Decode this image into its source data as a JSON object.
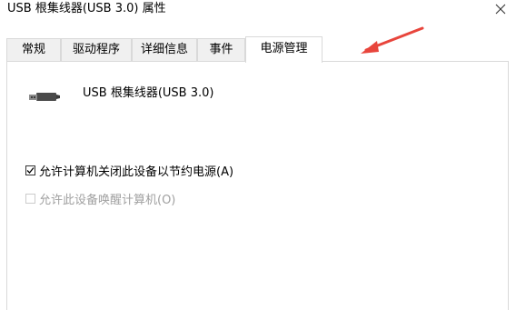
{
  "window": {
    "title": "USB 根集线器(USB 3.0) 属性",
    "close_glyph": "✕"
  },
  "tabs": [
    {
      "label": "常规",
      "active": false
    },
    {
      "label": "驱动程序",
      "active": false
    },
    {
      "label": "详细信息",
      "active": false
    },
    {
      "label": "事件",
      "active": false
    },
    {
      "label": "电源管理",
      "active": true
    }
  ],
  "device": {
    "name": "USB 根集线器(USB 3.0)",
    "icon": "usb-plug-icon"
  },
  "options": [
    {
      "label": "允许计算机关闭此设备以节约电源(A)",
      "checked": true,
      "enabled": true
    },
    {
      "label": "允许此设备唤醒计算机(O)",
      "checked": false,
      "enabled": false
    }
  ],
  "annotation": {
    "icon": "red-arrow-icon",
    "color": "#e8453c"
  }
}
